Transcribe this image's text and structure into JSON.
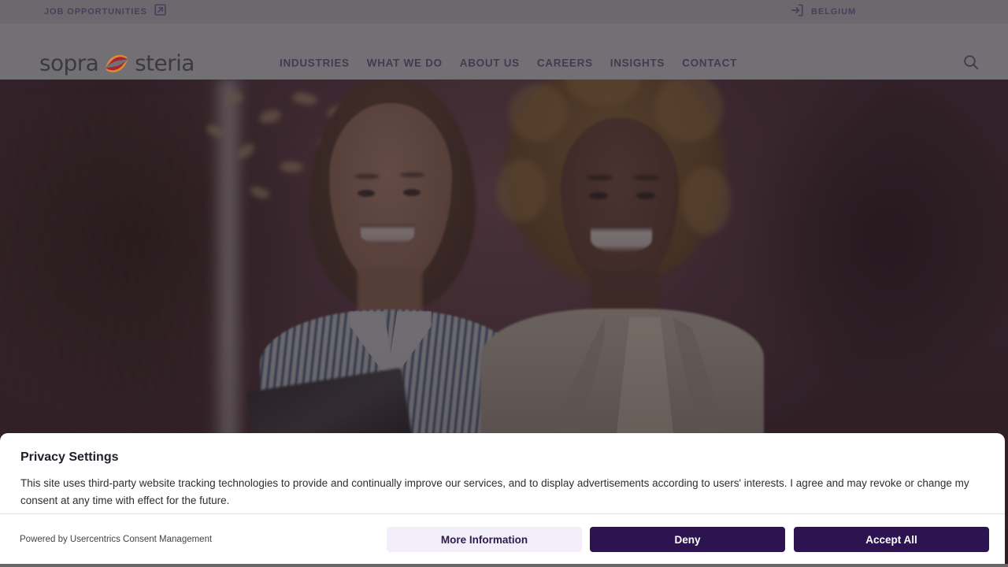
{
  "utility_bar": {
    "job_opportunities_label": "JOB OPPORTUNITIES",
    "job_opportunities_icon": "external-link-icon",
    "region_label": "BELGIUM",
    "region_icon": "enter-arrow-icon",
    "background_color": "#6b696d"
  },
  "header": {
    "logo": {
      "word_left": "sopra",
      "word_right": "steria",
      "mark_icon": "sopra-steria-s-mark",
      "mark_color_red": "#a62434",
      "mark_color_orange": "#e08a2e"
    },
    "nav": [
      {
        "label": "INDUSTRIES"
      },
      {
        "label": "WHAT WE DO"
      },
      {
        "label": "ABOUT US"
      },
      {
        "label": "CAREERS"
      },
      {
        "label": "INSIGHTS"
      },
      {
        "label": "CONTACT"
      }
    ],
    "search_icon": "search-icon",
    "background_color": "#727074",
    "text_color": "#413b52"
  },
  "hero": {
    "alt": "Two smiling women standing together indoors, one holding a tablet",
    "overlay_color": "rgba(46,40,48,0.36)"
  },
  "consent": {
    "title": "Privacy Settings",
    "body": "This site uses third-party website tracking technologies to provide and continually improve our services, and to display advertisements according to users' interests. I agree and may revoke or change my consent at any time with effect for the future.",
    "powered_by": "Powered by Usercentrics Consent Management",
    "buttons": [
      {
        "label": "More Information",
        "style": "secondary",
        "background": "#f2effa",
        "color": "#2f1a52"
      },
      {
        "label": "Deny",
        "style": "primary",
        "background": "#2d1450",
        "color": "#ffffff"
      },
      {
        "label": "Accept All",
        "style": "primary",
        "background": "#2d1450",
        "color": "#ffffff"
      }
    ]
  }
}
